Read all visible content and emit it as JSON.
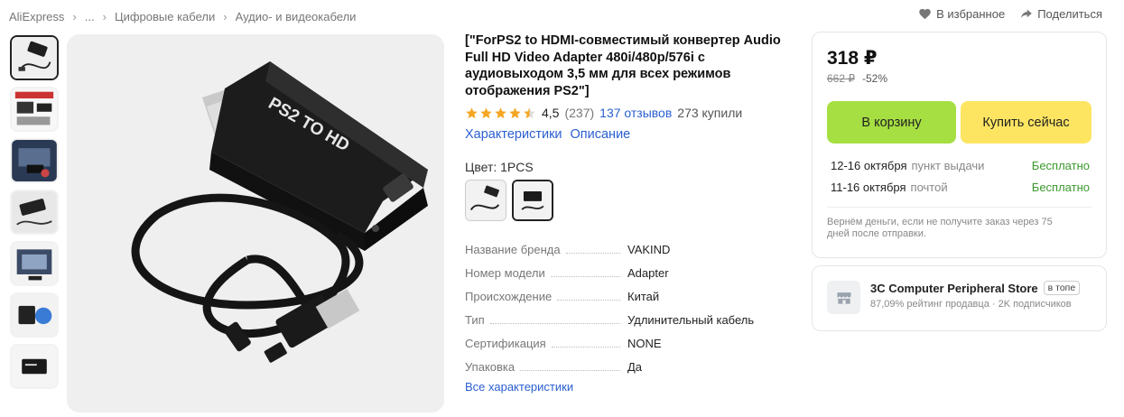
{
  "breadcrumb": [
    "AliExpress",
    "...",
    "Цифровые кабели",
    "Аудио- и видеокабели"
  ],
  "top_actions": {
    "favorite": "В избранное",
    "share": "Поделиться"
  },
  "product": {
    "title": "[\"ForPS2 to HDMI-совместимый конвертер Audio Full HD Video Adapter 480i/480p/576i с аудиовыходом 3,5 мм для всех режимов отображения PS2\"]",
    "rating": "4,5",
    "rating_value": 4.5,
    "rating_count": "(237)",
    "reviews": "137 отзывов",
    "sold": "273 купили",
    "tabs": [
      "Характеристики",
      "Описание"
    ],
    "color_label": "Цвет: 1PCS",
    "device_label": "PS2 TO HD"
  },
  "specs": [
    {
      "key": "Название бренда",
      "value": "VAKIND"
    },
    {
      "key": "Номер модели",
      "value": "Adapter"
    },
    {
      "key": "Происхождение",
      "value": "Китай"
    },
    {
      "key": "Тип",
      "value": "Удлинительный кабель"
    },
    {
      "key": "Сертификация",
      "value": "NONE"
    },
    {
      "key": "Упаковка",
      "value": "Да"
    }
  ],
  "all_specs_link": "Все характеристики",
  "buy": {
    "price": "318 ₽",
    "old_price": "662 ₽",
    "discount": "-52%",
    "cart_button": "В корзину",
    "buy_now_button": "Купить сейчас",
    "delivery": [
      {
        "dates": "12-16 октября",
        "method": "пункт выдачи",
        "cost": "Бесплатно"
      },
      {
        "dates": "11-16 октября",
        "method": "почтой",
        "cost": "Бесплатно"
      }
    ],
    "refund_note": "Вернём деньги, если не получите заказ через 75 дней после отправки."
  },
  "store": {
    "name": "3C Computer Peripheral Store",
    "badge": "в топе",
    "meta": "87,09% рейтинг продавца · 2K подписчиков"
  },
  "colors": {
    "cart": "#a6df42",
    "buy": "#fde562",
    "star": "#f5a623",
    "link": "#2a5fd1",
    "free": "#3c9a2e"
  }
}
